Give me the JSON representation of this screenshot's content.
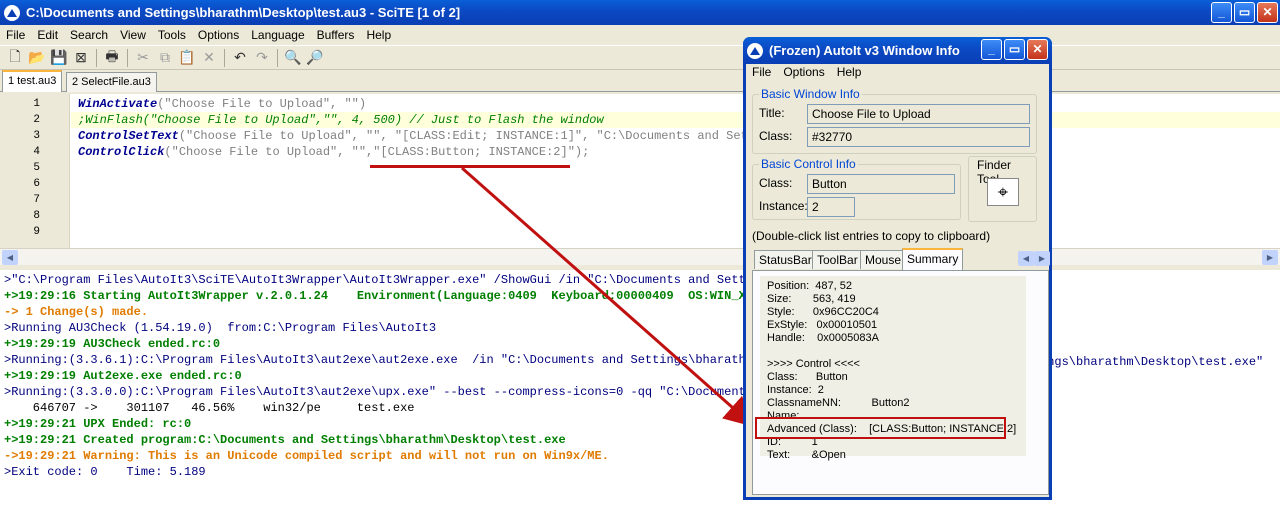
{
  "scite": {
    "title": "C:\\Documents and Settings\\bharathm\\Desktop\\test.au3 - SciTE [1 of 2]",
    "window_controls": [
      "_",
      "▭",
      "✕"
    ],
    "menu": [
      "File",
      "Edit",
      "Search",
      "View",
      "Tools",
      "Options",
      "Language",
      "Buffers",
      "Help"
    ],
    "tabs": [
      "1 test.au3",
      "2 SelectFile.au3"
    ],
    "line_numbers": [
      "1",
      "2",
      "3",
      "4",
      "5",
      "6",
      "7",
      "8",
      "9"
    ],
    "code": {
      "l1_fn": "WinActivate",
      "l1_rest": "(\"Choose File to Upload\", \"\")",
      "l2": ";WinFlash(\"Choose File to Upload\",\"\", 4, 500) // Just to Flash the window",
      "l3_fn": "ControlSetText",
      "l3_rest": "(\"Choose File to Upload\", \"\", \"[CLASS:Edit; INSTANCE:1]\", \"C:\\Documents and Setti",
      "l4_fn": "ControlClick",
      "l4_rest": "(\"Choose File to Upload\", \"\",\"[CLASS:Button; INSTANCE:2]\");"
    },
    "output": [
      {
        "text": ">\"C:\\Program Files\\AutoIt3\\SciTE\\AutoIt3Wrapper\\AutoIt3Wrapper.exe\" /ShowGui /in \"C:\\Documents and Settin",
        "color": "blue"
      },
      {
        "text": "+>19:29:16 Starting AutoIt3Wrapper v.2.0.1.24    Environment(Language:0409  Keyboard:00000409  OS:WIN_XP/",
        "color": "green"
      },
      {
        "text": "-> 1 Change(s) made.",
        "color": "orange"
      },
      {
        "text": ">Running AU3Check (1.54.19.0)  from:C:\\Program Files\\AutoIt3",
        "color": "blue"
      },
      {
        "text": "+>19:29:19 AU3Check ended.rc:0",
        "color": "green"
      },
      {
        "text": ">Running:(3.3.6.1):C:\\Program Files\\AutoIt3\\aut2exe\\aut2exe.exe  /in \"C:\\Documents and Settings\\bharathm",
        "color": "blue"
      },
      {
        "text": "+>19:29:19 Aut2exe.exe ended.rc:0",
        "color": "green"
      },
      {
        "text": ">Running:(3.3.0.0):C:\\Program Files\\AutoIt3\\aut2exe\\upx.exe\" --best --compress-icons=0 -qq \"C:\\Documents",
        "color": "blue"
      },
      {
        "text": "    646707 ->    301107   46.56%    win32/pe     test.exe",
        "color": "plain"
      },
      {
        "text": "+>19:29:21 UPX Ended: rc:0",
        "color": "green"
      },
      {
        "text": "+>19:29:21 Created program:C:\\Documents and Settings\\bharathm\\Desktop\\test.exe",
        "color": "green"
      },
      {
        "text": "->19:29:21 Warning: This is an Unicode compiled script and will not run on Win9x/ME.",
        "color": "orange"
      },
      {
        "text": ">Exit code: 0    Time: 5.189",
        "color": "blue"
      }
    ],
    "output_tail_line6": "ings\\bharathm\\Desktop\\test.exe\""
  },
  "autoit": {
    "title": "(Frozen) AutoIt v3 Window Info",
    "menu": [
      "File",
      "Options",
      "Help"
    ],
    "basic_window": {
      "label": "Basic Window Info",
      "title_label": "Title:",
      "title_value": "Choose File to Upload",
      "class_label": "Class:",
      "class_value": "#32770"
    },
    "basic_control": {
      "label": "Basic Control Info",
      "class_label": "Class:",
      "class_value": "Button",
      "instance_label": "Instance:",
      "instance_value": "2"
    },
    "finder_tool": "Finder Tool",
    "hint": "(Double-click list entries to copy to clipboard)",
    "tabs": [
      "StatusBar",
      "ToolBar",
      "Mouse",
      "Summary"
    ],
    "summary": [
      "Position:  487, 52",
      "Size:       563, 419",
      "Style:      0x96CC20C4",
      "ExStyle:   0x00010501",
      "Handle:    0x0005083A",
      "",
      ">>>> Control <<<<",
      "Class:      Button",
      "Instance:  2",
      "ClassnameNN:          Button2",
      "Name:",
      "Advanced (Class):    [CLASS:Button; INSTANCE:2]",
      "ID:          1",
      "Text:       &Open"
    ]
  },
  "colors": {
    "annotation": "#c01010",
    "titlebar": "#0a4ec6",
    "function": "#000090",
    "comment": "#008000",
    "string": "#808080"
  }
}
